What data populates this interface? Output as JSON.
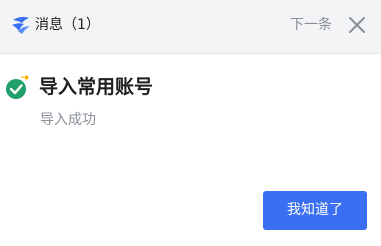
{
  "header": {
    "app_icon": "bird-logo-icon",
    "title": "消息（1）",
    "next_label": "下一条",
    "close_icon": "close-icon"
  },
  "message": {
    "status_icon": "check-circle-icon",
    "title": "导入常用账号",
    "subtitle": "导入成功"
  },
  "actions": {
    "ok_label": "我知道了"
  },
  "colors": {
    "accent": "#3a6ff2",
    "success": "#22a06b",
    "header_bg": "#f3f4f6",
    "muted_text": "#8a8f99"
  }
}
